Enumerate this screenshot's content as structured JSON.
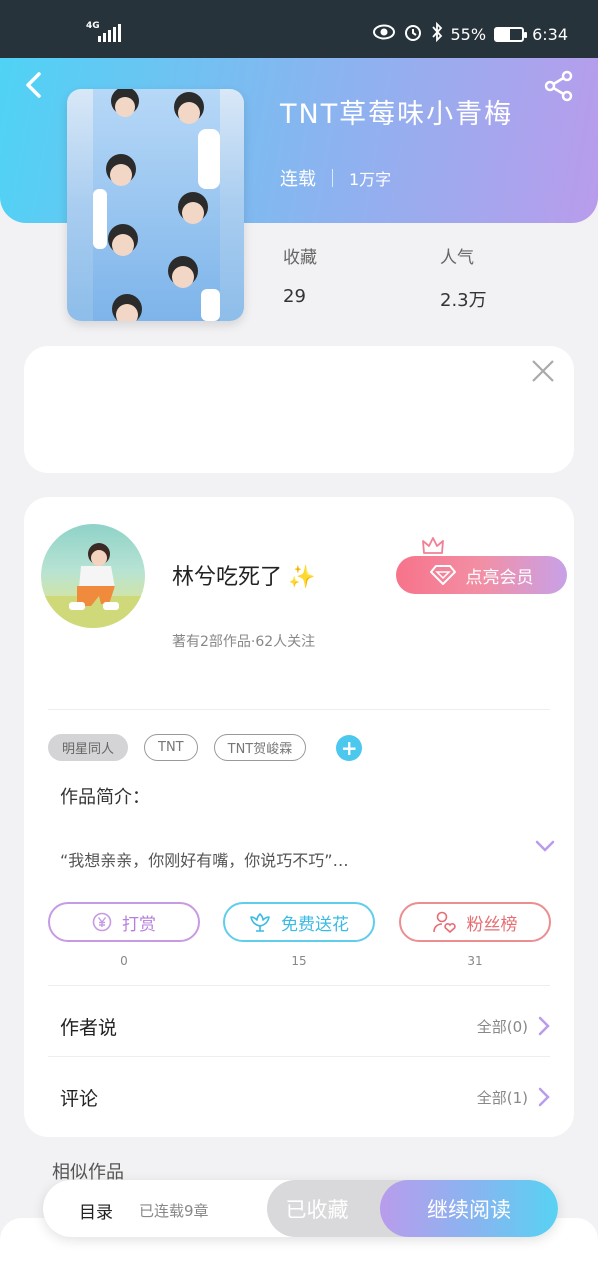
{
  "status_bar": {
    "network": "4G",
    "battery_percent": "55%",
    "time": "6:34",
    "battery_level": 0.55
  },
  "book": {
    "title": "TNT草莓味小青梅",
    "status": "连载",
    "word_count": "1万字"
  },
  "stats": [
    {
      "label": "收藏",
      "value": "29"
    },
    {
      "label": "人气",
      "value": "2.3万"
    }
  ],
  "author": {
    "name": "林兮吃死了",
    "sparkle": "✨",
    "info": "著有2部作品·62人关注",
    "vip_button": "点亮会员"
  },
  "tags": [
    "明星同人",
    "TNT",
    "TNT贺峻霖"
  ],
  "intro": {
    "label": "作品简介：",
    "text": "“我想亲亲，你刚好有嘴，你说巧不巧”…"
  },
  "actions": [
    {
      "label": "打赏",
      "count": "0"
    },
    {
      "label": "免费送花",
      "count": "15"
    },
    {
      "label": "粉丝榜",
      "count": "31"
    }
  ],
  "rows": {
    "author_says": {
      "label": "作者说",
      "value": "全部(0)"
    },
    "comments": {
      "label": "评论",
      "value": "全部(1)"
    }
  },
  "similar_label": "相似作品",
  "bottom_bar": {
    "toc": "目录",
    "toc_sub": "已连载9章",
    "collected": "已收藏",
    "continue": "继续阅读"
  },
  "colors": {
    "accent_cyan": "#4fd3f5",
    "accent_purple": "#b99cec",
    "vip_pink": "#f7738a"
  }
}
